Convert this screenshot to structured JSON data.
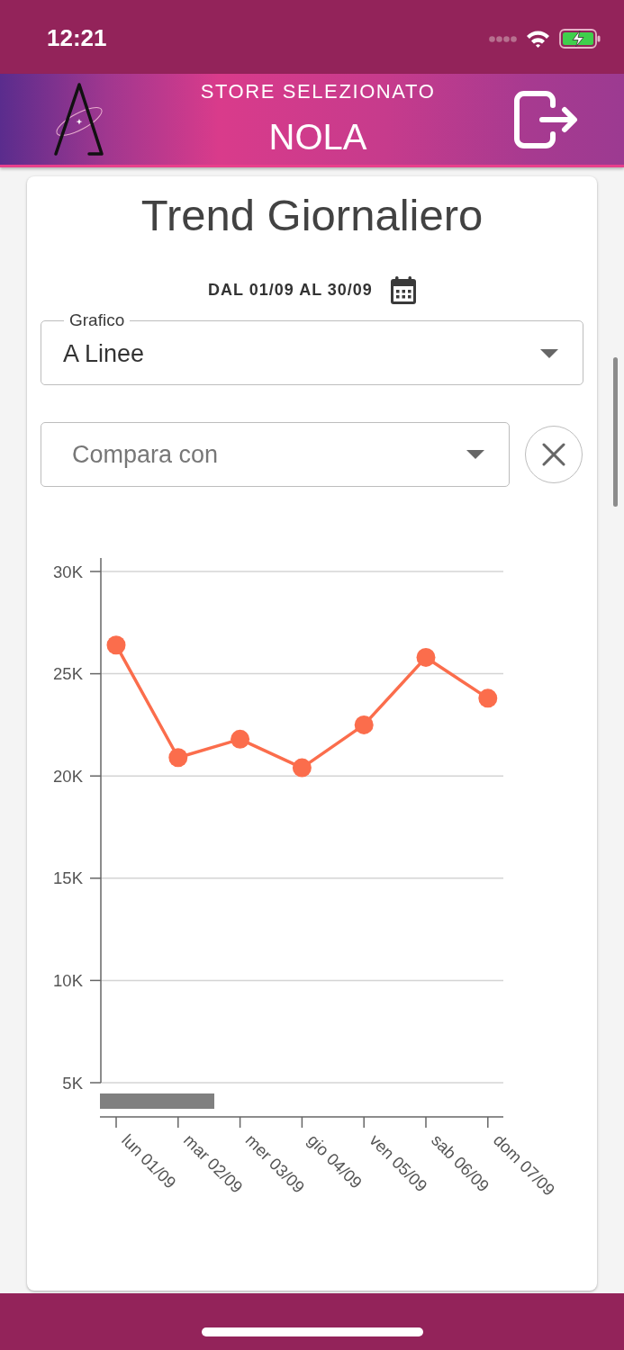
{
  "status_bar": {
    "time": "12:21"
  },
  "header": {
    "subtitle": "STORE SELEZIONATO",
    "store": "NOLA"
  },
  "card": {
    "title": "Trend Giornaliero",
    "date_range": "DAL 01/09 AL 30/09",
    "chart_type_field": {
      "label": "Grafico",
      "value": "A Linee"
    },
    "compare_field": {
      "placeholder": "Compara con"
    },
    "chart_data": {
      "type": "line",
      "categories": [
        "lun 01/09",
        "mar 02/09",
        "mer 03/09",
        "gio 04/09",
        "ven 05/09",
        "sab 06/09",
        "dom 07/09"
      ],
      "series": [
        {
          "color": "#fb6d4c",
          "marker": "circle",
          "values": [
            26400,
            20900,
            21800,
            20400,
            22500,
            25800,
            23800
          ]
        }
      ],
      "ylim": [
        5000,
        30000
      ],
      "yticks": [
        {
          "value": 30000,
          "label": "30K"
        },
        {
          "value": 25000,
          "label": "25K"
        },
        {
          "value": 20000,
          "label": "20K"
        },
        {
          "value": 15000,
          "label": "15K"
        },
        {
          "value": 10000,
          "label": "10K"
        },
        {
          "value": 5000,
          "label": "5K"
        }
      ],
      "grid": true
    }
  }
}
